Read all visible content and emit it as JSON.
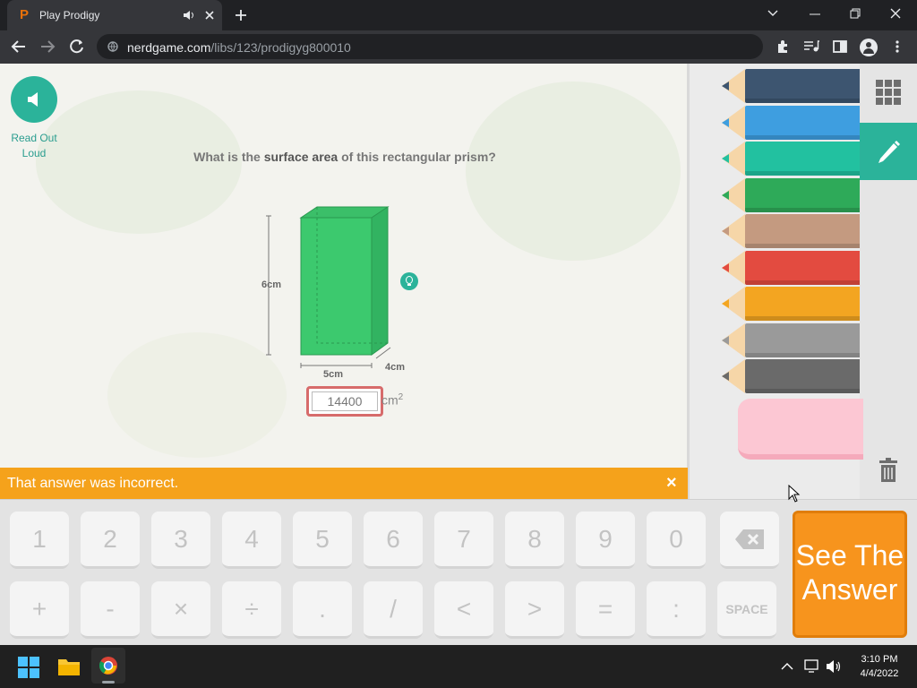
{
  "browser": {
    "tab_title": "Play Prodigy",
    "url_domain": "nerdgame.com",
    "url_path": "/libs/123/prodigyg800010"
  },
  "page": {
    "readout_label": "Read Out Loud",
    "question_pre": "What is the ",
    "question_bold": "surface area",
    "question_post": " of this rectangular prism?",
    "dim_height": "6cm",
    "dim_width": "5cm",
    "dim_depth": "4cm",
    "answer_value": "14400",
    "unit": "cm",
    "unit_exp": "2",
    "prism_color": "#3cc96e"
  },
  "banner": {
    "text": "That answer was incorrect.",
    "close": "×"
  },
  "pencils": [
    {
      "color": "#3d5570",
      "icon": "pencil-icon"
    },
    {
      "color": "#3e9ee0",
      "icon": "pencil-icon"
    },
    {
      "color": "#22c1a0",
      "icon": "pencil-icon"
    },
    {
      "color": "#2eaa59",
      "icon": "pencil-icon"
    },
    {
      "color": "#c49a80",
      "icon": "pencil-icon"
    },
    {
      "color": "#e34b40",
      "icon": "pencil-icon"
    },
    {
      "color": "#f3a521",
      "icon": "pencil-icon"
    },
    {
      "color": "#9a9a9a",
      "icon": "pencil-icon"
    },
    {
      "color": "#6a6a6a",
      "icon": "pencil-icon"
    }
  ],
  "keypad": {
    "row1": [
      "1",
      "2",
      "3",
      "4",
      "5",
      "6",
      "7",
      "8",
      "9",
      "0"
    ],
    "row2": [
      "+",
      "-",
      "×",
      "÷",
      ".",
      "/",
      "<",
      ">",
      "=",
      ":",
      "SPACE"
    ],
    "answer_line1": "See The",
    "answer_line2": "Answer"
  },
  "taskbar": {
    "time": "3:10 PM",
    "date": "4/4/2022"
  }
}
